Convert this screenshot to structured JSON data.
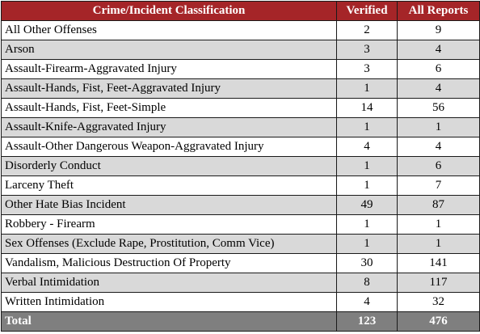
{
  "table": {
    "headers": [
      "Crime/Incident Classification",
      "Verified",
      "All Reports"
    ],
    "rows": [
      [
        "All Other Offenses",
        "2",
        "9"
      ],
      [
        "Arson",
        "3",
        "4"
      ],
      [
        "Assault-Firearm-Aggravated Injury",
        "3",
        "6"
      ],
      [
        "Assault-Hands, Fist, Feet-Aggravated Injury",
        "1",
        "4"
      ],
      [
        "Assault-Hands, Fist, Feet-Simple",
        "14",
        "56"
      ],
      [
        "Assault-Knife-Aggravated Injury",
        "1",
        "1"
      ],
      [
        "Assault-Other Dangerous Weapon-Aggravated Injury",
        "4",
        "4"
      ],
      [
        "Disorderly Conduct",
        "1",
        "6"
      ],
      [
        "Larceny Theft",
        "1",
        "7"
      ],
      [
        "Other Hate Bias Incident",
        "49",
        "87"
      ],
      [
        "Robbery - Firearm",
        "1",
        "1"
      ],
      [
        "Sex Offenses (Exclude Rape, Prostitution, Comm Vice)",
        "1",
        "1"
      ],
      [
        "Vandalism, Malicious Destruction Of Property",
        "30",
        "141"
      ],
      [
        "Verbal Intimidation",
        "8",
        "117"
      ],
      [
        "Written Intimidation",
        "4",
        "32"
      ]
    ],
    "total": [
      "Total",
      "123",
      "476"
    ]
  },
  "colors": {
    "header_bg": "#a52528",
    "header_text": "#ffffff",
    "stripe_bg": "#d9d9d9",
    "total_bg": "#7f7f7f",
    "border": "#1a1a1a"
  }
}
